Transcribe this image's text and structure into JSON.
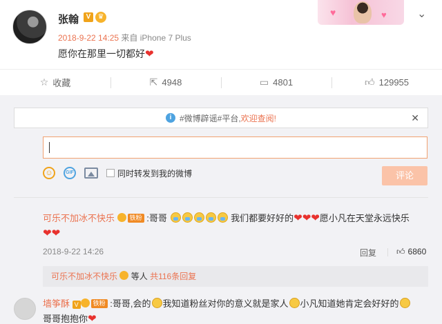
{
  "post": {
    "username": "张翰",
    "time": "2018-9-22 14:25",
    "source": "来自 iPhone 7 Plus",
    "text": "愿你在那里一切都好",
    "text_emoji": "❤️"
  },
  "actions": [
    {
      "icon": "star-icon",
      "label": "收藏"
    },
    {
      "icon": "share-icon",
      "label": "4948"
    },
    {
      "icon": "comment-icon",
      "label": "4801"
    },
    {
      "icon": "like-icon",
      "label": "129955"
    }
  ],
  "notice": {
    "prefix": "#微博辟谣#平台,",
    "highlight": "欢迎查阅!"
  },
  "composer": {
    "share_label": "同时转发到我的微博",
    "submit_label": "评论"
  },
  "comments": [
    {
      "user": "可乐不加冰不快乐",
      "fan_badge": "铁粉",
      "text_a": ":哥哥",
      "text_b": "我们都要好好的",
      "text_c": "愿小凡在天堂永远快乐",
      "time": "2018-9-22 14:26",
      "reply_label": "回复",
      "likes": "6860"
    },
    {
      "user": "墙筝酥",
      "fan_badge": "铁粉",
      "text_a": ":哥哥,会的",
      "text_b": "我知道粉丝对你的意义就是家人",
      "text_c": "小凡知道她肯定会好好的",
      "text_d": "哥哥抱抱你"
    }
  ],
  "sub_reply": {
    "user": "可乐不加冰不快乐",
    "suffix": "等人",
    "count": "共116条回复"
  },
  "colors": {
    "accent": "#eb7350",
    "badge": "#f08a24",
    "submit_disabled": "#fbc3a8"
  }
}
